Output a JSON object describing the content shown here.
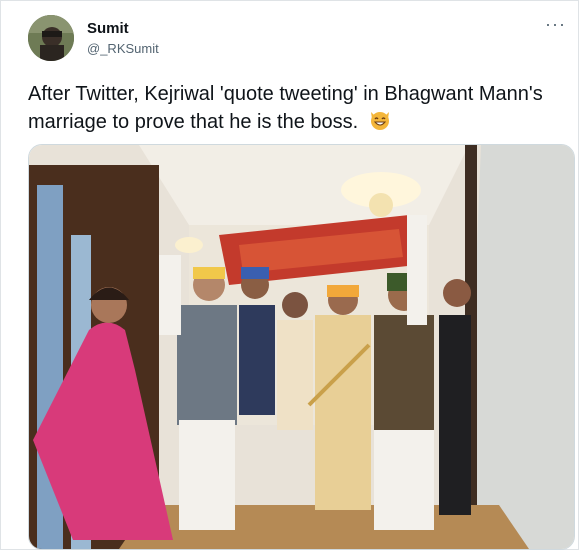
{
  "author": {
    "name": "Sumit",
    "handle": "@_RKSumit"
  },
  "menu": {
    "more_label": "···",
    "more_icon": "more-horizontal-icon"
  },
  "tweet": {
    "text": "After Twitter, Kejriwal 'quote tweeting' in Bhagwant Mann's marriage to prove that he is the boss.",
    "emoji": "grinning-cat-icon"
  },
  "media": {
    "alt": "photo"
  },
  "colors": {
    "text": "#0f1419",
    "secondary": "#536471",
    "border": "#cfd9de"
  }
}
